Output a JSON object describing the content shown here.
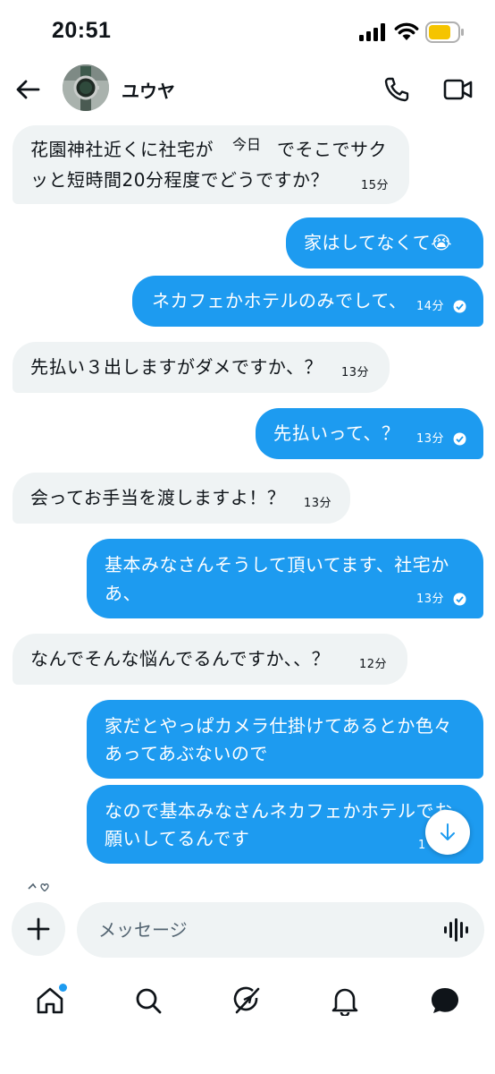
{
  "status_bar": {
    "time": "20:51",
    "battery_color": "#f5c400"
  },
  "header": {
    "contact_name": "ユウヤ"
  },
  "date_chip": "今日",
  "messages": [
    {
      "direction": "in",
      "lines": [
        "花園神社近くに社宅が",
        "ッと短時間20分程度でどうですか？"
      ],
      "line1_tail": "でそこでサク",
      "time": "15分"
    },
    {
      "direction": "out",
      "text": "家はしてなくて😭",
      "time": ""
    },
    {
      "direction": "out",
      "text": "ネカフェかホテルのみでして、",
      "time": "14分"
    },
    {
      "direction": "in",
      "text": "先払い３出しますがダメですか、？",
      "time": "13分"
    },
    {
      "direction": "out",
      "text": "先払いって、？",
      "time": "13分"
    },
    {
      "direction": "in",
      "text": "会ってお手当を渡しますよ！？",
      "time": "13分"
    },
    {
      "direction": "out",
      "lines": [
        "基本みなさんそうして頂いてます、社宅か",
        "あ、"
      ],
      "time": "13分"
    },
    {
      "direction": "in",
      "text": "なんでそんな悩んでるんですか、、？",
      "time": "12分"
    },
    {
      "direction": "out",
      "lines": [
        "家だとやっぱカメラ仕掛けてあるとか色々",
        "あってあぶないので"
      ],
      "time": ""
    },
    {
      "direction": "out",
      "lines": [
        "なので基本みなさんネカフェかホテルでお",
        "願いしてるんです"
      ],
      "time": "1"
    }
  ],
  "composer": {
    "placeholder": "メッセージ"
  },
  "colors": {
    "accent": "#1d9bf0",
    "incoming_bubble": "#eff3f4"
  },
  "nav": [
    "home-icon",
    "search-icon",
    "grok-icon",
    "notifications-icon",
    "messages-icon"
  ]
}
